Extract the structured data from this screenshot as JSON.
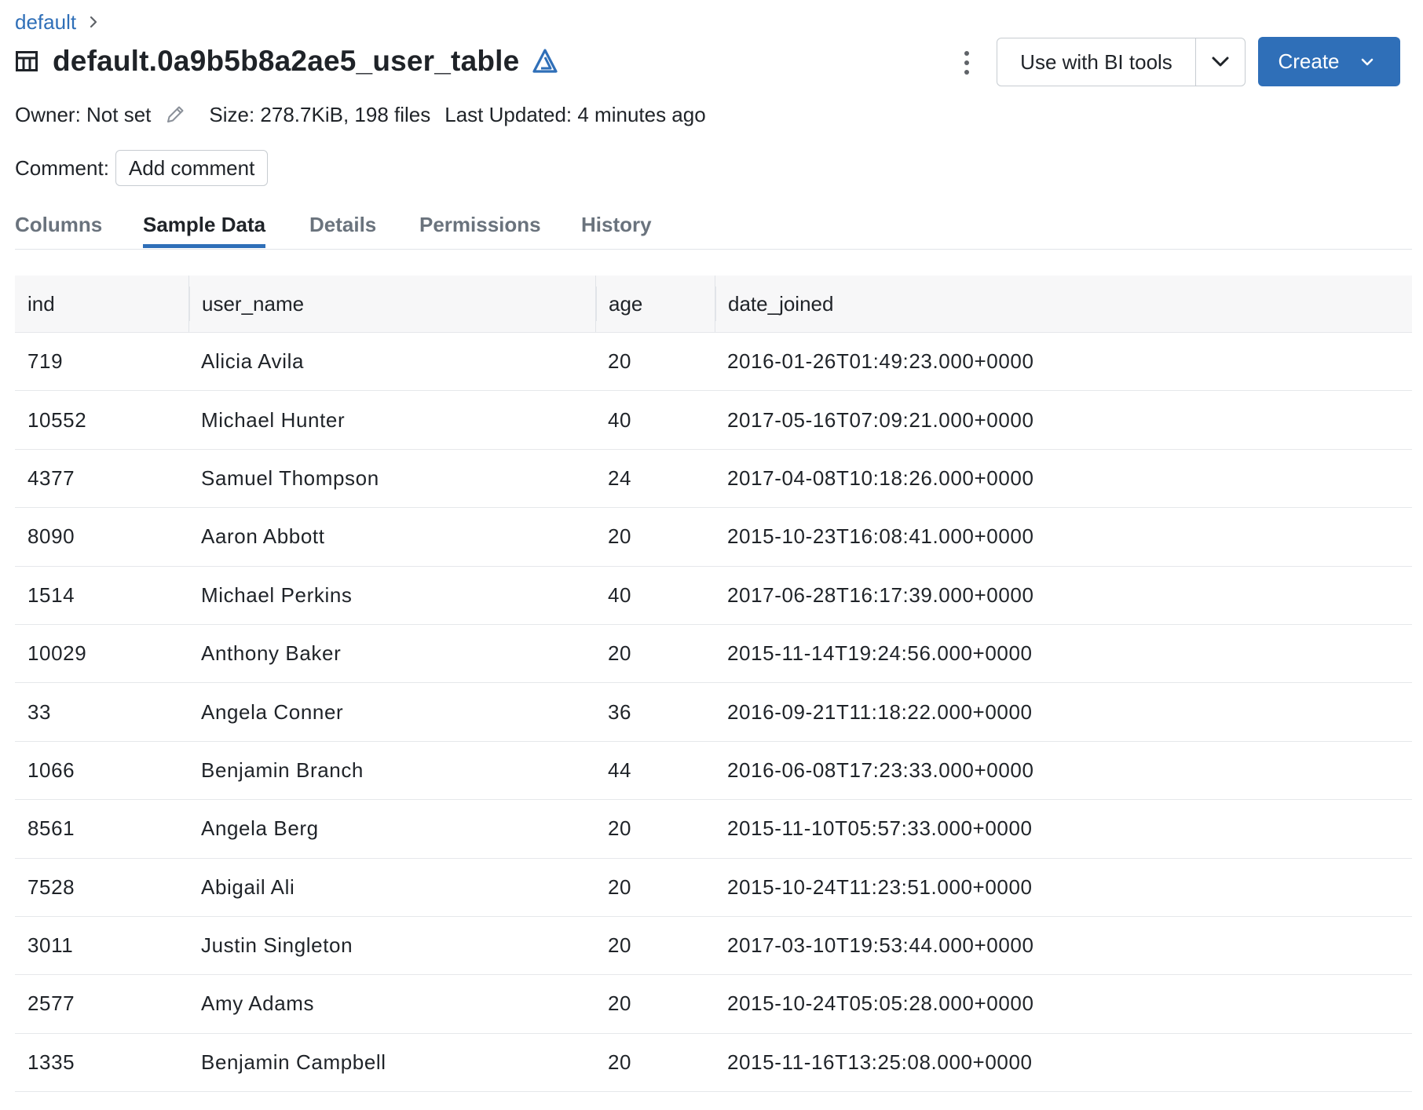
{
  "breadcrumb": {
    "items": [
      "default"
    ]
  },
  "header": {
    "title": "default.0a9b5b8a2ae5_user_table",
    "table_icon": "table-icon",
    "delta_icon": "delta-lake-icon"
  },
  "actions": {
    "more_icon": "kebab-menu-icon",
    "bi_label": "Use with BI tools",
    "create_label": "Create"
  },
  "meta": {
    "owner": "Owner: Not set",
    "size": "Size: 278.7KiB, 198 files",
    "last_updated": "Last Updated: 4 minutes ago"
  },
  "comment": {
    "label": "Comment:",
    "button": "Add comment"
  },
  "tabs": [
    {
      "label": "Columns"
    },
    {
      "label": "Sample Data",
      "active": true
    },
    {
      "label": "Details"
    },
    {
      "label": "Permissions"
    },
    {
      "label": "History"
    }
  ],
  "table": {
    "columns": [
      "ind",
      "user_name",
      "age",
      "date_joined"
    ],
    "rows": [
      [
        "719",
        "Alicia Avila",
        "20",
        "2016-01-26T01:49:23.000+0000"
      ],
      [
        "10552",
        "Michael Hunter",
        "40",
        "2017-05-16T07:09:21.000+0000"
      ],
      [
        "4377",
        "Samuel Thompson",
        "24",
        "2017-04-08T10:18:26.000+0000"
      ],
      [
        "8090",
        "Aaron Abbott",
        "20",
        "2015-10-23T16:08:41.000+0000"
      ],
      [
        "1514",
        "Michael Perkins",
        "40",
        "2017-06-28T16:17:39.000+0000"
      ],
      [
        "10029",
        "Anthony Baker",
        "20",
        "2015-11-14T19:24:56.000+0000"
      ],
      [
        "33",
        "Angela Conner",
        "36",
        "2016-09-21T11:18:22.000+0000"
      ],
      [
        "1066",
        "Benjamin Branch",
        "44",
        "2016-06-08T17:23:33.000+0000"
      ],
      [
        "8561",
        "Angela Berg",
        "20",
        "2015-11-10T05:57:33.000+0000"
      ],
      [
        "7528",
        "Abigail Ali",
        "20",
        "2015-10-24T11:23:51.000+0000"
      ],
      [
        "3011",
        "Justin Singleton",
        "20",
        "2017-03-10T19:53:44.000+0000"
      ],
      [
        "2577",
        "Amy Adams",
        "20",
        "2015-10-24T05:05:28.000+0000"
      ],
      [
        "1335",
        "Benjamin Campbell",
        "20",
        "2015-11-16T13:25:08.000+0000"
      ]
    ]
  },
  "colors": {
    "accent": "#2f6fb8",
    "text": "#1f2328",
    "muted": "#6a737d"
  }
}
